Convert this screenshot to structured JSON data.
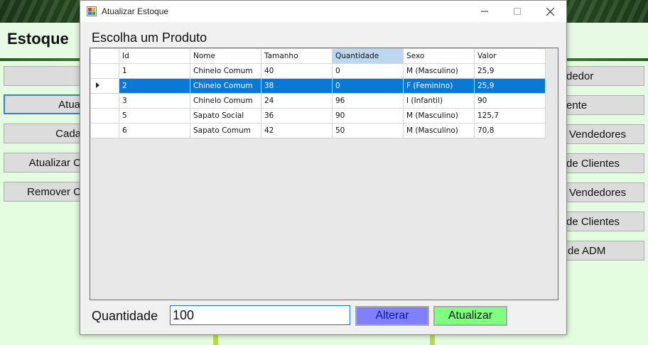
{
  "main": {
    "title": "Estoque",
    "left_buttons": [
      "",
      "Atua",
      "Cada",
      "Atualizar C",
      "Remover C"
    ],
    "right_buttons": [
      "dedor",
      "ente",
      "Vendedores",
      "de Clientes",
      "Vendedores",
      "de Clientes",
      "de ADM"
    ]
  },
  "dialog": {
    "title": "Atualizar Estoque",
    "heading": "Escolha um Produto",
    "grid": {
      "columns": [
        "Id",
        "Nome",
        "Tamanho",
        "Quantidade",
        "Sexo",
        "Valor"
      ],
      "selected_column": "Quantidade",
      "rows": [
        {
          "id": "1",
          "nome": "Chinelo Comum",
          "tamanho": "40",
          "quantidade": "0",
          "sexo": "M (Masculino)",
          "valor": "25,9"
        },
        {
          "id": "2",
          "nome": "Chinelo Comum",
          "tamanho": "38",
          "quantidade": "0",
          "sexo": "F (Feminino)",
          "valor": "25,9"
        },
        {
          "id": "3",
          "nome": "Chinelo Comum",
          "tamanho": "24",
          "quantidade": "96",
          "sexo": "I (Infantil)",
          "valor": "90"
        },
        {
          "id": "5",
          "nome": "Sapato Social",
          "tamanho": "36",
          "quantidade": "90",
          "sexo": "M (Masculino)",
          "valor": "125,7"
        },
        {
          "id": "6",
          "nome": "Sapato Comum",
          "tamanho": "42",
          "quantidade": "50",
          "sexo": "M (Masculino)",
          "valor": "70,8"
        }
      ],
      "selected_row_index": 1
    },
    "quantity_label": "Quantidade",
    "quantity_value": "100",
    "alterar_label": "Alterar",
    "atualizar_label": "Atualizar"
  },
  "colors": {
    "selection": "#0a78d7",
    "alterar_bg": "#8080ff",
    "atualizar_bg": "#80ff80"
  }
}
